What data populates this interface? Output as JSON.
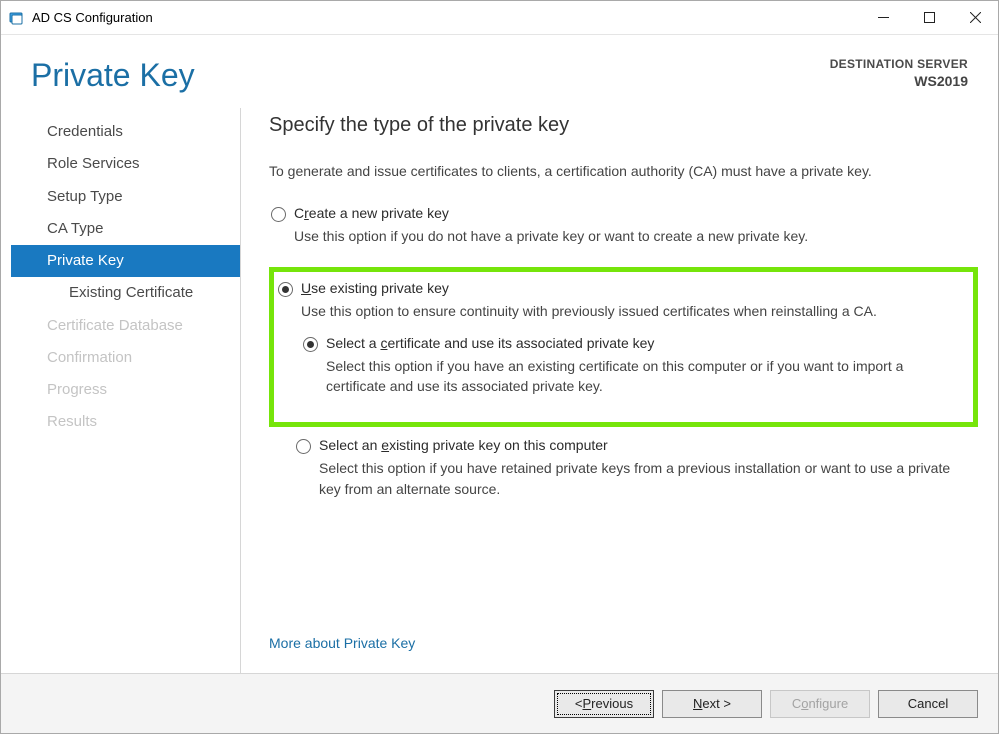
{
  "window": {
    "title": "AD CS Configuration"
  },
  "header": {
    "page_title": "Private Key",
    "dest_label": "DESTINATION SERVER",
    "dest_server": "WS2019"
  },
  "sidebar": {
    "items": [
      {
        "label": "Credentials",
        "state": "normal"
      },
      {
        "label": "Role Services",
        "state": "normal"
      },
      {
        "label": "Setup Type",
        "state": "normal"
      },
      {
        "label": "CA Type",
        "state": "normal"
      },
      {
        "label": "Private Key",
        "state": "active"
      },
      {
        "label": "Existing Certificate",
        "state": "sub"
      },
      {
        "label": "Certificate Database",
        "state": "disabled"
      },
      {
        "label": "Confirmation",
        "state": "disabled"
      },
      {
        "label": "Progress",
        "state": "disabled"
      },
      {
        "label": "Results",
        "state": "disabled"
      }
    ]
  },
  "main": {
    "section_title": "Specify the type of the private key",
    "intro": "To generate and issue certificates to clients, a certification authority (CA) must have a private key.",
    "opt1": {
      "pre": "C",
      "u": "r",
      "post": "eate a new private key",
      "desc": "Use this option if you do not have a private key or want to create a new private key."
    },
    "opt2": {
      "u": "U",
      "post": "se existing private key",
      "desc": "Use this option to ensure continuity with previously issued certificates when reinstalling a CA."
    },
    "opt2a": {
      "pre": "Select a ",
      "u": "c",
      "post": "ertificate and use its associated private key",
      "desc": "Select this option if you have an existing certificate on this computer or if you want to import a certificate and use its associated private key."
    },
    "opt2b": {
      "pre": "Select an ",
      "u": "e",
      "post": "xisting private key on this computer",
      "desc": "Select this option if you have retained private keys from a previous installation or want to use a private key from an alternate source."
    },
    "more_link": "More about Private Key"
  },
  "footer": {
    "previous": {
      "lt": "< ",
      "u": "P",
      "post": "revious"
    },
    "next": {
      "u": "N",
      "post": "ext >"
    },
    "configure": {
      "pre": "C",
      "u": "o",
      "post": "nfigure"
    },
    "cancel": "Cancel"
  }
}
